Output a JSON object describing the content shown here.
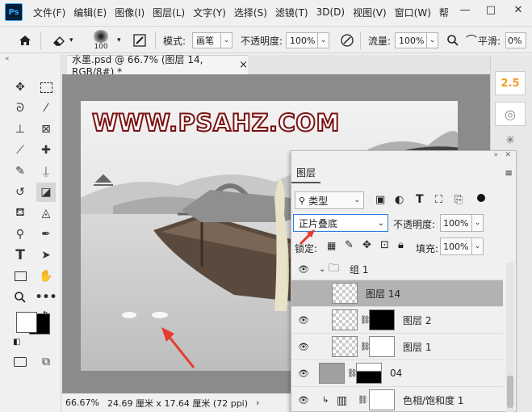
{
  "app": {
    "logo": "Ps"
  },
  "menu": [
    "文件(F)",
    "编辑(E)",
    "图像(I)",
    "图层(L)",
    "文字(Y)",
    "选择(S)",
    "滤镜(T)",
    "3D(D)",
    "视图(V)",
    "窗口(W)",
    "帮"
  ],
  "window_controls": {
    "minimize": "—",
    "maximize": "□",
    "close": "✕"
  },
  "options": {
    "brush_size": "100",
    "mode_label": "模式:",
    "mode_value": "画笔",
    "opacity_label": "不透明度:",
    "opacity_value": "100%",
    "flow_label": "流量:",
    "flow_value": "100%",
    "smooth_label": "平滑:",
    "smooth_value": "0%"
  },
  "document": {
    "tab_title": "水墨.psd @ 66.7% (图层 14, RGB/8#) *",
    "tab_close": "×",
    "canvas_watermark": "WWW.PSAHZ.COM"
  },
  "status": {
    "zoom": "66.67%",
    "doc_info": "24.69 厘米 x 17.64 厘米 (72 ppi)",
    "arrow": "›"
  },
  "right_strip": {
    "value": "2.5"
  },
  "layers_panel": {
    "tab": "图层",
    "filter_label": "类型",
    "blend_mode": "正片叠底",
    "opacity_label": "不透明度:",
    "opacity_value": "100%",
    "lock_label": "锁定:",
    "fill_label": "填充:",
    "fill_value": "100%",
    "layers": [
      {
        "name": "组 1",
        "type": "group"
      },
      {
        "name": "图层 14",
        "type": "layer",
        "selected": true
      },
      {
        "name": "图层 2",
        "type": "masked"
      },
      {
        "name": "图层 1",
        "type": "masked"
      },
      {
        "name": "04",
        "type": "masked"
      },
      {
        "name": "色相/饱和度 1",
        "type": "adjustment"
      }
    ]
  },
  "colors": {
    "accent": "#31a8ff",
    "watermark": "#ffffff",
    "watermark_outline": "#7a1010",
    "selected_layer": "#b2b2b2",
    "arrow_red": "#e53b2c"
  }
}
